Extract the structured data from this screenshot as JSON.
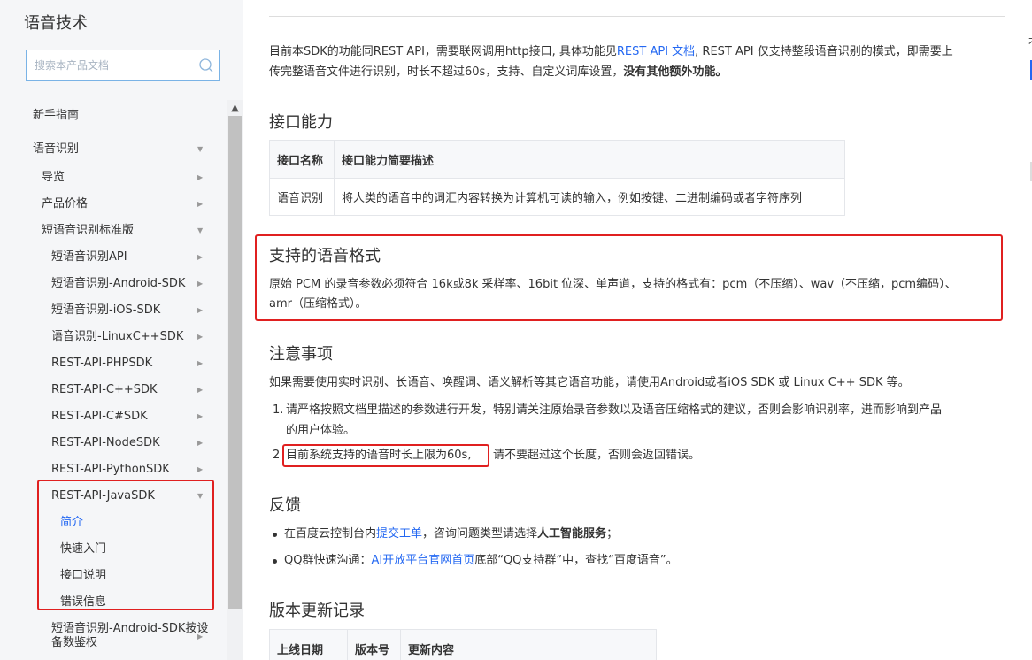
{
  "sidebar": {
    "title": "语音技术",
    "search_placeholder": "搜索本产品文档",
    "items": [
      {
        "label": "新手指南"
      },
      {
        "label": "语音识别"
      },
      {
        "label": "导览"
      },
      {
        "label": "产品价格"
      },
      {
        "label": "短语音识别标准版"
      },
      {
        "label": "短语音识别API"
      },
      {
        "label": "短语音识别-Android-SDK"
      },
      {
        "label": "短语音识别-iOS-SDK"
      },
      {
        "label": "语音识别-LinuxC++SDK"
      },
      {
        "label": "REST-API-PHPSDK"
      },
      {
        "label": "REST-API-C++SDK"
      },
      {
        "label": "REST-API-C#SDK"
      },
      {
        "label": "REST-API-NodeSDK"
      },
      {
        "label": "REST-API-PythonSDK"
      },
      {
        "label": "REST-API-JavaSDK"
      },
      {
        "label": "简介"
      },
      {
        "label": "快速入门"
      },
      {
        "label": "接口说明"
      },
      {
        "label": "错误信息"
      },
      {
        "label": "短语音识别-Android-SDK按设"
      },
      {
        "label": "备数鉴权"
      }
    ]
  },
  "intro": {
    "line1_a": "目前本SDK的功能同REST API，需要联网调用http接口, 具体功能见",
    "line1_link": "REST API 文档",
    "line1_b": ", REST API 仅支持整段语音识别的模式，即需要上",
    "line2_a": "传完整语音文件进行识别，时长不超过60s，支持、自定义词库设置，",
    "line2_bold": "没有其他额外功能。"
  },
  "capability": {
    "heading": "接口能力",
    "headers": [
      "接口名称",
      "接口能力简要描述"
    ],
    "rows": [
      [
        "语音识别",
        "将人类的语音中的词汇内容转换为计算机可读的输入，例如按键、二进制编码或者字符序列"
      ]
    ]
  },
  "formats": {
    "heading": "支持的语音格式",
    "line1": "原始 PCM 的录音参数必须符合 16k或8k 采样率、16bit 位深、单声道，支持的格式有：pcm（不压缩）、wav（不压缩，pcm编码）、",
    "line2": "amr（压缩格式）。"
  },
  "notes": {
    "heading": "注意事项",
    "intro": "如果需要使用实时识别、长语音、唤醒词、语义解析等其它语音功能，请使用Android或者iOS SDK 或 Linux C++ SDK 等。",
    "item1_num": "1.",
    "item1_line1": "请严格按照文档里描述的参数进行开发，特别请关注原始录音参数以及语音压缩格式的建议，否则会影响识别率，进而影响到产品",
    "item1_line2": "的用户体验。",
    "item2_num": "2",
    "item2_boxed": "目前系统支持的语音时长上限为60s,",
    "item2_rest": "请不要超过这个长度，否则会返回错误。"
  },
  "feedback": {
    "heading": "反馈",
    "b1_a": "在百度云控制台内",
    "b1_link": "提交工单",
    "b1_b": "，咨询问题类型请选择",
    "b1_bold": "人工智能服务",
    "b1_c": "；",
    "b2_a": "QQ群快速沟通：",
    "b2_link": "AI开放平台官网首页",
    "b2_b": "底部“QQ支持群”中，查找“百度语音”。"
  },
  "changelog": {
    "heading": "版本更新记录",
    "headers": [
      "上线日期",
      "版本号",
      "更新内容"
    ]
  },
  "right_peek": {
    "glyph": "才"
  },
  "colors": {
    "accent": "#2468f2",
    "highlight_red": "#e02020"
  }
}
